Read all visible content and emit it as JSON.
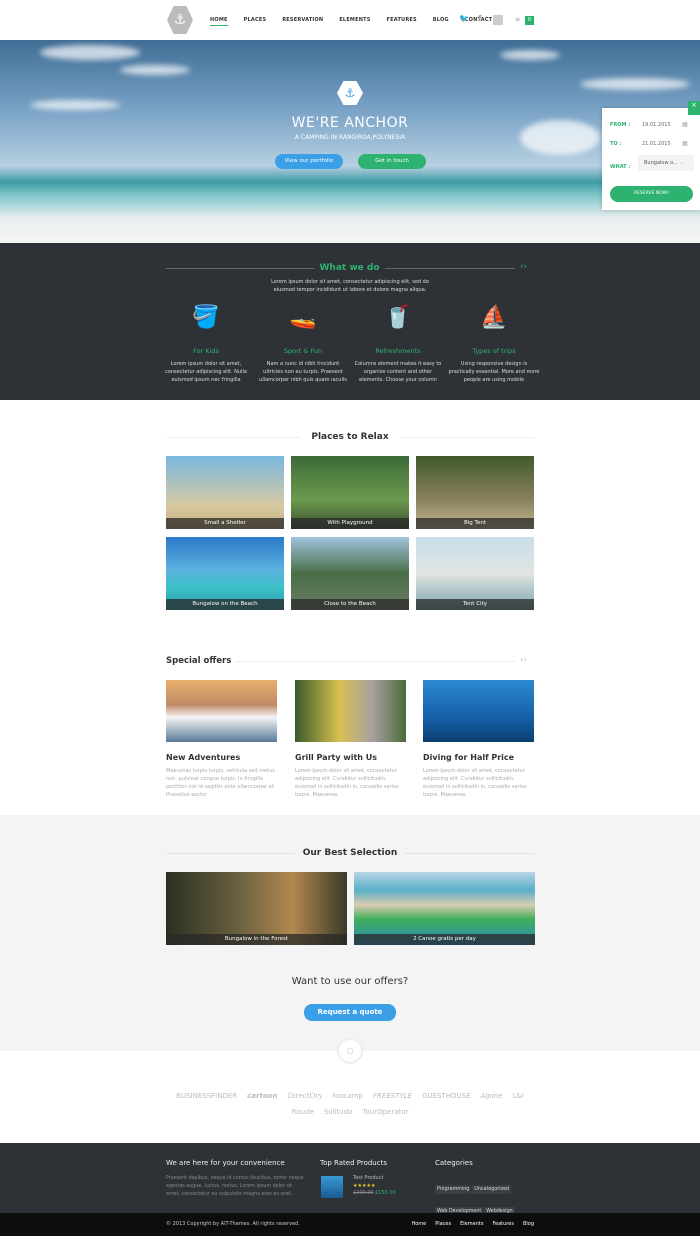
{
  "header": {
    "logo_icon": "anchor-icon",
    "nav": [
      "HOME",
      "PLACES",
      "RESERVATION",
      "ELEMENTS",
      "FEATURES",
      "BLOG",
      "CONTACT"
    ],
    "cart_count": "0"
  },
  "hero": {
    "title": "WE'RE ANCHOR",
    "subtitle": "A CAMPING IN RANGIROA,POLYNESIA",
    "btn_portfolio": "View our portfolio",
    "btn_touch": "Get in touch"
  },
  "reservation": {
    "from_label": "FROM :",
    "from_value": "19.01.2015",
    "to_label": "TO :",
    "to_value": "21.01.2015",
    "what_label": "WHAT :",
    "what_value": "Bungalow o...",
    "submit": "RESERVE NOW!",
    "close": "×"
  },
  "what_we_do": {
    "title": "What we do",
    "intro": "Lorem ipsum dolor sit amet, consectetur adipiscing elit, sed do eiusmod tempor incididunt ut labore et dolore magna aliqua.",
    "items": [
      {
        "title": "For Kids",
        "text": "Lorem ipsum dolor sit amet, consectetur adipiscing elit. Nulla euismod ipsum nec fringilla"
      },
      {
        "title": "Sport & Fun",
        "text": "Nam a nunc id nibh tincidunt ultricies non eu turpis. Praesent ullamcorper nibh quis quam iaculis"
      },
      {
        "title": "Refreshments",
        "text": "Columns element makes it easy to organize content and other elements. Choose your column"
      },
      {
        "title": "Types of trips",
        "text": "Using responsive design is practically essential. More and more people are using mobile"
      }
    ]
  },
  "places": {
    "title": "Places to Relax",
    "items": [
      "Small a Shetler",
      "With Playground",
      "Big Tent",
      "Bungalow on the Beach",
      "Close to the Beach",
      "Tent City"
    ]
  },
  "offers": {
    "title": "Special offers",
    "items": [
      {
        "title": "New Adventures",
        "text": "Maecenas turpis turpis, vehicula sed metus non, pulvinar congue turpis. In fringilla porttitor nisi id sagittis ante ullamcorper et. Phasellus auctor"
      },
      {
        "title": "Grill Party with Us",
        "text": "Lorem ipsum dolor sit amet, consectetur adipiscing elit. Curabitur sollicitudin, euismod in sollicitudin in, convallis varius turpis. Maecenas"
      },
      {
        "title": "Diving for Half Price",
        "text": "Lorem ipsum dolor sit amet, consectetur adipiscing elit. Curabitur sollicitudin, euismod in sollicitudin in, convallis varius turpis. Maecenas"
      }
    ]
  },
  "best": {
    "title": "Our Best Selection",
    "items": [
      "Bungalow in the Forest",
      "2 Canoe gratis per day"
    ],
    "cta": "Want to use our offers?",
    "button": "Request a quote"
  },
  "partners": [
    "BUSINESSFINDER",
    "cartoon",
    "DirectOry",
    "foocamp",
    "FREESTYLE",
    "GUESTHOUSE",
    "Alpine",
    "L&I",
    "Roude",
    "Solitudo",
    "TourOperator"
  ],
  "footer": {
    "col1_title": "We are here for your convenience",
    "col1_text": "Praesent dapibus, neque id cursus faucibus, tortor neque egestas augue, luctus, metus. Lorem ipsum dolor sit amet, consectetur eu vulputate magna eros eu erat.",
    "col2_title": "Top Rated Products",
    "product_name": "Test Product",
    "product_stars": "★★★★★",
    "old_price": "£200.00",
    "new_price": "£150.00",
    "col3_title": "Categories",
    "categories": [
      "Programming",
      "Uncategorized",
      "Web Development",
      "Webdesign"
    ]
  },
  "bottom": {
    "copyright": "© 2013 Copyright by AIT-Themes. All rights reserved.",
    "links": [
      "Home",
      "Places",
      "Elements",
      "Features",
      "Blog"
    ]
  },
  "colors": {
    "accent": "#2db36f",
    "blue": "#3b9fe8",
    "dark": "#2e3237"
  }
}
